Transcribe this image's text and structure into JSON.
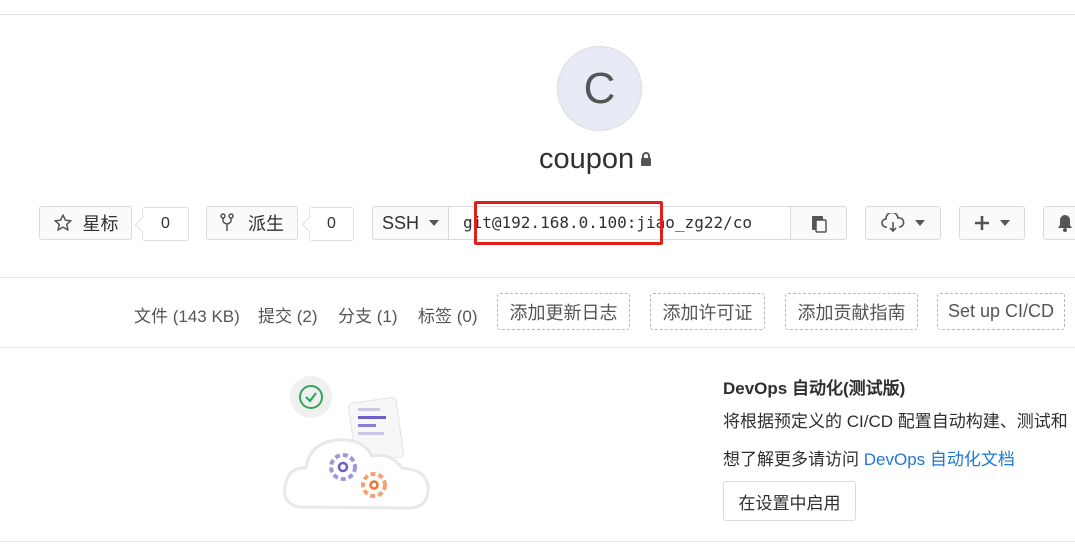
{
  "project": {
    "avatar_letter": "C",
    "name": "coupon",
    "visibility_icon": "lock-icon"
  },
  "actions": {
    "star_label": "星标",
    "star_count": "0",
    "fork_label": "派生",
    "fork_count": "0",
    "clone_protocol": "SSH",
    "clone_url": "git@192.168.0.100:jiao_zg22/co",
    "highlight_color": "#e0211b"
  },
  "stats": {
    "files": "文件 (143 KB)",
    "commits": "提交 (2)",
    "branches": "分支 (1)",
    "tags": "标签 (0)"
  },
  "quick_actions": [
    "添加更新日志",
    "添加许可证",
    "添加贡献指南",
    "Set up CI/CD"
  ],
  "devops": {
    "title": "DevOps 自动化(测试版)",
    "description": "将根据预定义的 CI/CD 配置自动构建、测试和",
    "more_prefix": "想了解更多请访问 ",
    "more_link": "DevOps 自动化文档",
    "enable_button": "在设置中启用",
    "link_color": "#1f78d1"
  }
}
